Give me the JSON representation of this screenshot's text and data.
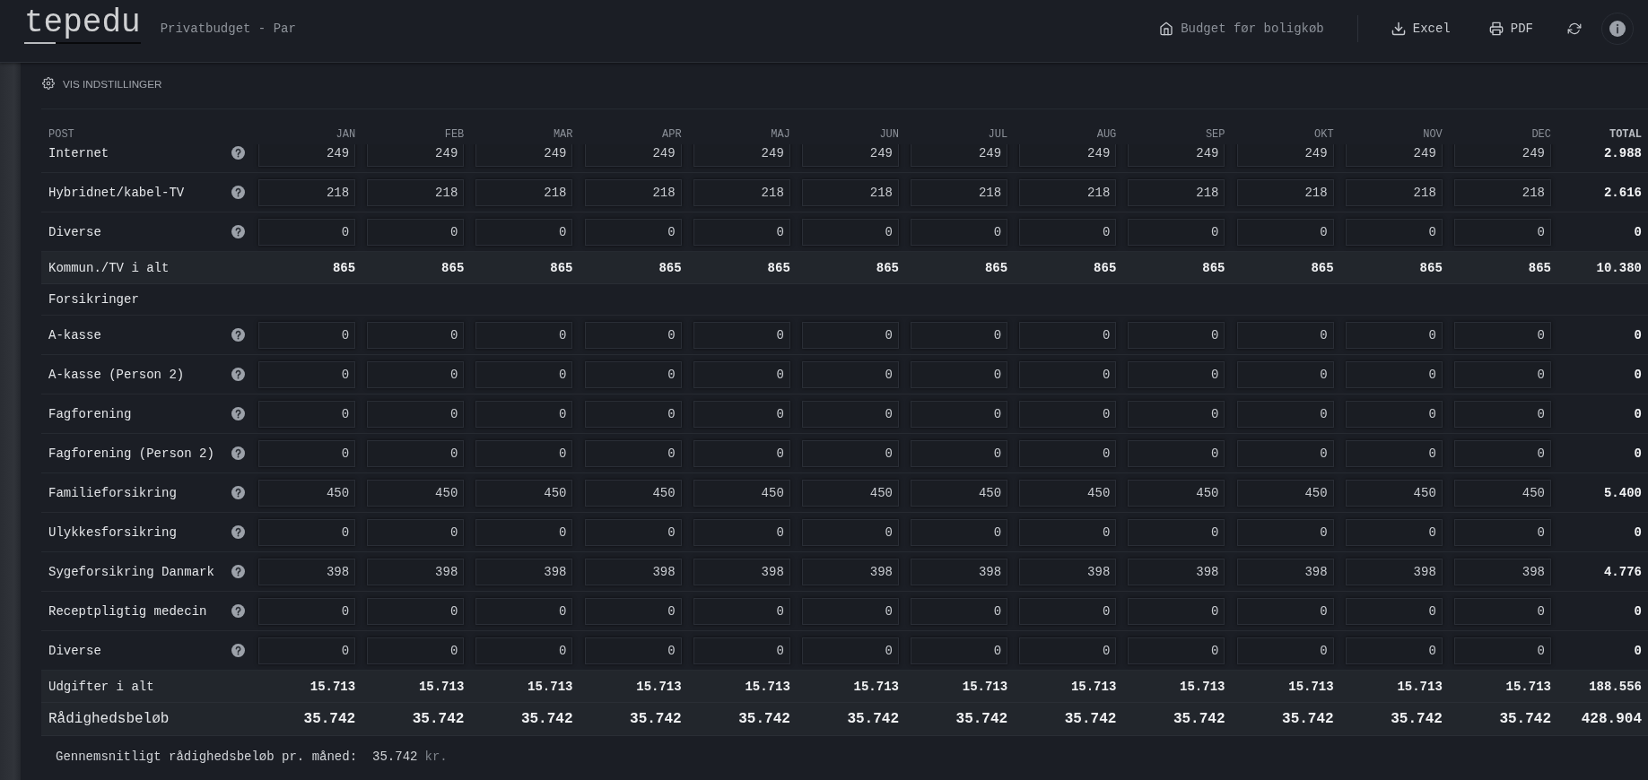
{
  "header": {
    "logo": "tepedu",
    "subtitle": "Privatbudget - Par",
    "actions": [
      {
        "kind": "home",
        "label": "Budget før boligkøb"
      },
      {
        "kind": "download",
        "label": "Excel"
      },
      {
        "kind": "print",
        "label": "PDF"
      },
      {
        "kind": "refresh"
      },
      {
        "kind": "info"
      }
    ]
  },
  "settings": {
    "label": "VIS INDSTILLINGER"
  },
  "table": {
    "columns": [
      "POST",
      "JAN",
      "FEB",
      "MAR",
      "APR",
      "MAJ",
      "JUN",
      "JUL",
      "AUG",
      "SEP",
      "OKT",
      "NOV",
      "DEC",
      "TOTAL"
    ],
    "rows": [
      {
        "kind": "item",
        "label": "Internet",
        "values": [
          "249",
          "249",
          "249",
          "249",
          "249",
          "249",
          "249",
          "249",
          "249",
          "249",
          "249",
          "249"
        ],
        "total": "2.988"
      },
      {
        "kind": "item",
        "label": "Hybridnet/kabel-TV",
        "values": [
          "218",
          "218",
          "218",
          "218",
          "218",
          "218",
          "218",
          "218",
          "218",
          "218",
          "218",
          "218"
        ],
        "total": "2.616"
      },
      {
        "kind": "item",
        "label": "Diverse",
        "values": [
          "0",
          "0",
          "0",
          "0",
          "0",
          "0",
          "0",
          "0",
          "0",
          "0",
          "0",
          "0"
        ],
        "total": "0"
      },
      {
        "kind": "subtotal",
        "label": "Kommun./TV i alt",
        "values": [
          "865",
          "865",
          "865",
          "865",
          "865",
          "865",
          "865",
          "865",
          "865",
          "865",
          "865",
          "865"
        ],
        "total": "10.380"
      },
      {
        "kind": "section",
        "label": "Forsikringer"
      },
      {
        "kind": "item",
        "label": "A-kasse",
        "values": [
          "0",
          "0",
          "0",
          "0",
          "0",
          "0",
          "0",
          "0",
          "0",
          "0",
          "0",
          "0"
        ],
        "total": "0"
      },
      {
        "kind": "item",
        "label": "A-kasse (Person 2)",
        "values": [
          "0",
          "0",
          "0",
          "0",
          "0",
          "0",
          "0",
          "0",
          "0",
          "0",
          "0",
          "0"
        ],
        "total": "0"
      },
      {
        "kind": "item",
        "label": "Fagforening",
        "values": [
          "0",
          "0",
          "0",
          "0",
          "0",
          "0",
          "0",
          "0",
          "0",
          "0",
          "0",
          "0"
        ],
        "total": "0"
      },
      {
        "kind": "item",
        "label": "Fagforening (Person 2)",
        "values": [
          "0",
          "0",
          "0",
          "0",
          "0",
          "0",
          "0",
          "0",
          "0",
          "0",
          "0",
          "0"
        ],
        "total": "0"
      },
      {
        "kind": "item",
        "label": "Familieforsikring",
        "values": [
          "450",
          "450",
          "450",
          "450",
          "450",
          "450",
          "450",
          "450",
          "450",
          "450",
          "450",
          "450"
        ],
        "total": "5.400"
      },
      {
        "kind": "item",
        "label": "Ulykkesforsikring",
        "values": [
          "0",
          "0",
          "0",
          "0",
          "0",
          "0",
          "0",
          "0",
          "0",
          "0",
          "0",
          "0"
        ],
        "total": "0"
      },
      {
        "kind": "item",
        "label": "Sygeforsikring Danmark",
        "values": [
          "398",
          "398",
          "398",
          "398",
          "398",
          "398",
          "398",
          "398",
          "398",
          "398",
          "398",
          "398"
        ],
        "total": "4.776"
      },
      {
        "kind": "item",
        "label": "Receptpligtig medecin",
        "values": [
          "0",
          "0",
          "0",
          "0",
          "0",
          "0",
          "0",
          "0",
          "0",
          "0",
          "0",
          "0"
        ],
        "total": "0"
      },
      {
        "kind": "item",
        "label": "Diverse",
        "values": [
          "0",
          "0",
          "0",
          "0",
          "0",
          "0",
          "0",
          "0",
          "0",
          "0",
          "0",
          "0"
        ],
        "total": "0"
      },
      {
        "kind": "subtotal",
        "label": "Udgifter i alt",
        "values": [
          "15.713",
          "15.713",
          "15.713",
          "15.713",
          "15.713",
          "15.713",
          "15.713",
          "15.713",
          "15.713",
          "15.713",
          "15.713",
          "15.713"
        ],
        "total": "188.556"
      },
      {
        "kind": "result",
        "label": "Rådighedsbeløb",
        "values": [
          "35.742",
          "35.742",
          "35.742",
          "35.742",
          "35.742",
          "35.742",
          "35.742",
          "35.742",
          "35.742",
          "35.742",
          "35.742",
          "35.742"
        ],
        "total": "428.904"
      }
    ]
  },
  "summary": {
    "label": "Gennemsnitligt rådighedsbeløb pr. måned:",
    "value": "35.742",
    "unit": "kr."
  }
}
